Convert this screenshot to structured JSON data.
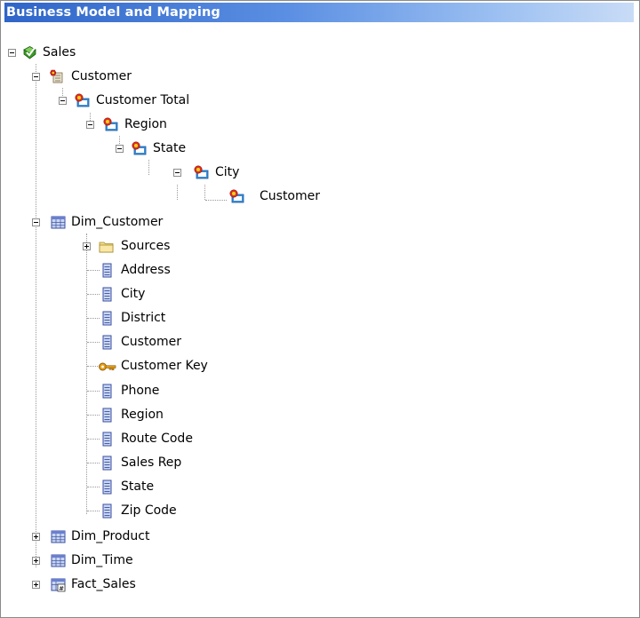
{
  "panel": {
    "title": "Business Model and Mapping"
  },
  "tree": [
    {
      "id": "sales",
      "label": "Sales",
      "icon": "business-model-icon",
      "toggle": "minus"
    },
    {
      "id": "customer-hierarchy",
      "label": "Customer",
      "icon": "dimension-hierarchy-icon",
      "toggle": "minus"
    },
    {
      "id": "customer-total",
      "label": "Customer Total",
      "icon": "hierarchy-level-icon",
      "toggle": "minus"
    },
    {
      "id": "level-region",
      "label": "Region",
      "icon": "hierarchy-level-icon",
      "toggle": "minus"
    },
    {
      "id": "level-state",
      "label": "State",
      "icon": "hierarchy-level-icon",
      "toggle": "minus"
    },
    {
      "id": "level-city",
      "label": "City",
      "icon": "hierarchy-level-icon",
      "toggle": "minus"
    },
    {
      "id": "level-customer",
      "label": "Customer",
      "icon": "hierarchy-level-icon",
      "toggle": "none"
    },
    {
      "id": "dim-customer",
      "label": "Dim_Customer",
      "icon": "logical-table-icon",
      "toggle": "minus"
    },
    {
      "id": "sources",
      "label": "Sources",
      "icon": "folder-icon",
      "toggle": "plus"
    },
    {
      "id": "col-address",
      "label": "Address",
      "icon": "column-icon",
      "toggle": "none"
    },
    {
      "id": "col-city",
      "label": "City",
      "icon": "column-icon",
      "toggle": "none"
    },
    {
      "id": "col-district",
      "label": "District",
      "icon": "column-icon",
      "toggle": "none"
    },
    {
      "id": "col-customer",
      "label": "Customer",
      "icon": "column-icon",
      "toggle": "none"
    },
    {
      "id": "col-customer-key",
      "label": "Customer Key",
      "icon": "key-icon",
      "toggle": "none"
    },
    {
      "id": "col-phone",
      "label": "Phone",
      "icon": "column-icon",
      "toggle": "none"
    },
    {
      "id": "col-region",
      "label": "Region",
      "icon": "column-icon",
      "toggle": "none"
    },
    {
      "id": "col-route-code",
      "label": "Route Code",
      "icon": "column-icon",
      "toggle": "none"
    },
    {
      "id": "col-sales-rep",
      "label": "Sales Rep",
      "icon": "column-icon",
      "toggle": "none"
    },
    {
      "id": "col-state",
      "label": "State",
      "icon": "column-icon",
      "toggle": "none"
    },
    {
      "id": "col-zip-code",
      "label": "Zip Code",
      "icon": "column-icon",
      "toggle": "none"
    },
    {
      "id": "dim-product",
      "label": "Dim_Product",
      "icon": "logical-table-icon",
      "toggle": "plus"
    },
    {
      "id": "dim-time",
      "label": "Dim_Time",
      "icon": "logical-table-icon",
      "toggle": "plus"
    },
    {
      "id": "fact-sales",
      "label": "Fact_Sales",
      "icon": "fact-table-icon",
      "toggle": "plus"
    }
  ]
}
